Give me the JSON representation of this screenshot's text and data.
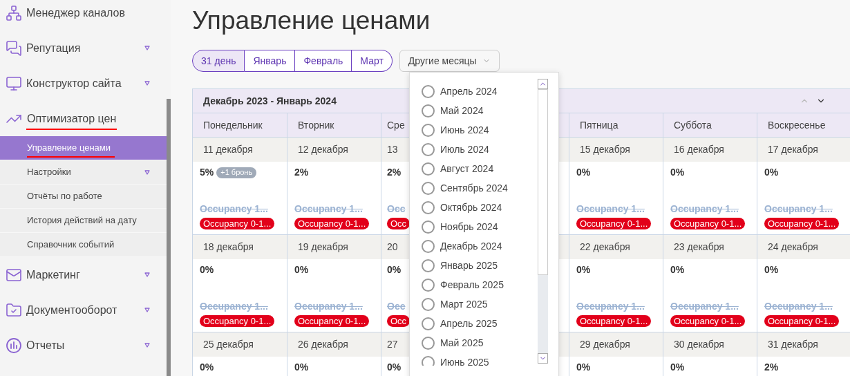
{
  "sidebar": {
    "items": [
      {
        "label": "Менеджер каналов",
        "expandable": false,
        "annotated": false
      },
      {
        "label": "Репутация",
        "expandable": true,
        "annotated": false
      },
      {
        "label": "Конструктор сайта",
        "expandable": true,
        "annotated": false
      },
      {
        "label": "Оптимизатор цен",
        "expandable": false,
        "annotated": true,
        "children": [
          {
            "label": "Управление ценами",
            "selected": true,
            "expandable": false,
            "annotated": true
          },
          {
            "label": "Настройки",
            "selected": false,
            "expandable": true,
            "annotated": false
          },
          {
            "label": "Отчёты по работе",
            "selected": false,
            "expandable": false,
            "annotated": false
          },
          {
            "label": "История действий на дату",
            "selected": false,
            "expandable": false,
            "annotated": false
          },
          {
            "label": "Справочник событий",
            "selected": false,
            "expandable": false,
            "annotated": false
          }
        ]
      },
      {
        "label": "Маркетинг",
        "expandable": true,
        "annotated": false
      },
      {
        "label": "Документооборот",
        "expandable": true,
        "annotated": false
      },
      {
        "label": "Отчеты",
        "expandable": true,
        "annotated": false
      }
    ]
  },
  "page_title": "Управление ценами",
  "period_tabs": [
    {
      "label": "31 день",
      "selected": true
    },
    {
      "label": "Январь",
      "selected": false
    },
    {
      "label": "Февраль",
      "selected": false
    },
    {
      "label": "Март",
      "selected": false
    }
  ],
  "other_months": {
    "label": "Другие месяцы",
    "options": [
      {
        "label": "Апрель 2024",
        "selected": false
      },
      {
        "label": "Май 2024",
        "selected": false
      },
      {
        "label": "Июнь 2024",
        "selected": false
      },
      {
        "label": "Июль 2024",
        "selected": false
      },
      {
        "label": "Август 2024",
        "selected": false
      },
      {
        "label": "Сентябрь 2024",
        "selected": false
      },
      {
        "label": "Октябрь 2024",
        "selected": false
      },
      {
        "label": "Ноябрь 2024",
        "selected": false
      },
      {
        "label": "Декабрь 2024",
        "selected": false
      },
      {
        "label": "Январь 2025",
        "selected": false
      },
      {
        "label": "Февраль 2025",
        "selected": false
      },
      {
        "label": "Март 2025",
        "selected": false
      },
      {
        "label": "Апрель 2025",
        "selected": false
      },
      {
        "label": "Май 2025",
        "selected": false
      },
      {
        "label": "Июнь 2025",
        "selected": false
      }
    ]
  },
  "calendar": {
    "title": "Декабрь 2023 - Январь 2024",
    "columns": [
      {
        "label": "Понедельник",
        "kind": "full"
      },
      {
        "label": "Вторник",
        "kind": "full"
      },
      {
        "label": "Сре",
        "kind": "clipped"
      },
      {
        "label": "Пятница",
        "kind": "full"
      },
      {
        "label": "Суббота",
        "kind": "full"
      },
      {
        "label": "Воскресенье",
        "kind": "full"
      }
    ],
    "weeks": [
      {
        "days": [
          {
            "date": "11 декабря",
            "percent": "5%",
            "badge": "+1 бронь",
            "rule_old": "Occupancy 1...",
            "rule_new": "Occupancy 0-1..."
          },
          {
            "date": "12 декабря",
            "percent": "2%",
            "rule_old": "Occupancy 1...",
            "rule_new": "Occupancy 0-1..."
          },
          {
            "date": "13",
            "percent": "2%",
            "rule_old": "Occ",
            "rule_new": "Occ"
          },
          {
            "date": "15 декабря",
            "percent": "0%",
            "rule_old": "Occupancy 1...",
            "rule_new": "Occupancy 0-1..."
          },
          {
            "date": "16 декабря",
            "percent": "0%",
            "rule_old": "Occupancy 1...",
            "rule_new": "Occupancy 0-1..."
          },
          {
            "date": "17 декабря",
            "percent": "0%",
            "rule_old": "Occupancy 1...",
            "rule_new": "Occupancy 0-1..."
          }
        ]
      },
      {
        "days": [
          {
            "date": "18 декабря",
            "percent": "0%",
            "rule_old": "Occupancy 1...",
            "rule_new": "Occupancy 0-1..."
          },
          {
            "date": "19 декабря",
            "percent": "0%",
            "rule_old": "Occupancy 1...",
            "rule_new": "Occupancy 0-1..."
          },
          {
            "date": "20",
            "percent": "0%",
            "rule_old": "Occ",
            "rule_new": "Occ"
          },
          {
            "date": "22 декабря",
            "percent": "0%",
            "rule_old": "Occupancy 1...",
            "rule_new": "Occupancy 0-1..."
          },
          {
            "date": "23 декабря",
            "percent": "0%",
            "rule_old": "Occupancy 1...",
            "rule_new": "Occupancy 0-1..."
          },
          {
            "date": "24 декабря",
            "percent": "0%",
            "rule_old": "Occupancy 1...",
            "rule_new": "Occupancy 0-1..."
          }
        ]
      },
      {
        "days": [
          {
            "date": "25 декабря",
            "percent": "0%"
          },
          {
            "date": "26 декабря",
            "percent": "0%"
          },
          {
            "date": "27",
            "percent": "0%"
          },
          {
            "date": "29 декабря",
            "percent": "0%"
          },
          {
            "date": "30 декабря",
            "percent": "0%"
          },
          {
            "date": "31 декабря",
            "percent": "2%"
          }
        ]
      }
    ]
  }
}
